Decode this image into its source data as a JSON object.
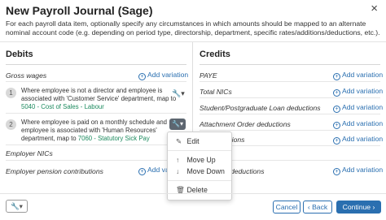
{
  "dialog": {
    "title": "New Payroll Journal (Sage)",
    "description": "For each payroll data item, optionally specify any circumstances in which amounts should be mapped to an alternate nominal account code (e.g. depending on period type, directorship, department, specific rates/additions/deductions, etc.).",
    "close_glyph": "×"
  },
  "debits": {
    "heading": "Debits",
    "rows": [
      {
        "label": "Gross wages",
        "action": "Add variation"
      },
      {
        "label": "Employer NICs",
        "action": "Add variation"
      },
      {
        "label": "Employer pension contributions",
        "action": "Add variation"
      }
    ],
    "rules": [
      {
        "num": "1",
        "line1": "Where employee is not a director and employee is",
        "line2": "associated with 'Customer Service' department, map to",
        "code": "5040 - Cost of Sales - Labour"
      },
      {
        "num": "2",
        "line1": "Where employee is paid on a monthly schedule and",
        "line2": "employee is associated with 'Human Resources'",
        "line3_prefix": "department, map to",
        "code": "7060 - Statutory Sick Pay"
      }
    ]
  },
  "credits": {
    "heading": "Credits",
    "rows": [
      {
        "label": "PAYE",
        "action": "Add variation"
      },
      {
        "label": "Total NICs",
        "action": "Add variation"
      },
      {
        "label": "Student/Postgraduate Loan deductions",
        "action": "Add variation"
      },
      {
        "label": "Attachment Order deductions",
        "action": "Add variation"
      },
      {
        "label": "ctions",
        "action": "Add variation"
      },
      {
        "label": "on deductions",
        "action": "Add variation"
      }
    ]
  },
  "context_menu": {
    "edit": "Edit",
    "move_up": "Move Up",
    "move_down": "Move Down",
    "delete": "Delete"
  },
  "footer": {
    "cancel": "Cancel",
    "back": "Back",
    "continue": "Continue"
  },
  "colors": {
    "accent": "#2a6fb0",
    "link_green": "#1c8a5e",
    "menu_button": "#5d6670"
  },
  "icons": [
    "close-icon",
    "plus-circle-icon",
    "wrench-icon",
    "pencil-icon",
    "arrow-up-icon",
    "arrow-down-icon",
    "trash-icon",
    "chevron-left-icon",
    "chevron-right-icon"
  ]
}
